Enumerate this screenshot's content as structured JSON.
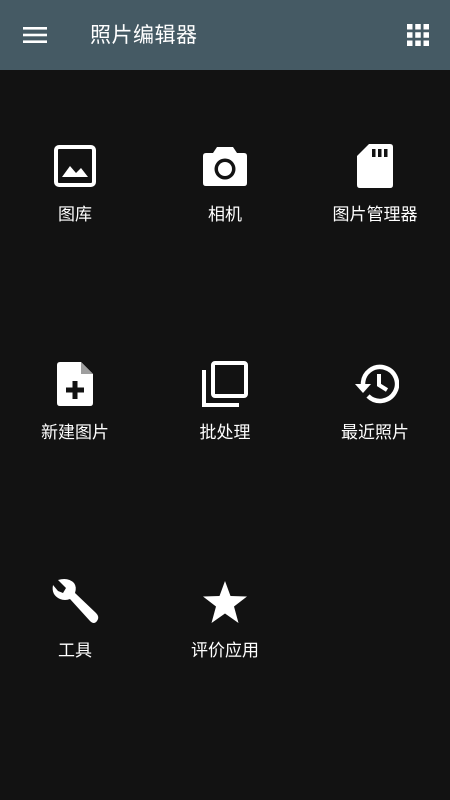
{
  "app_bar": {
    "title": "照片编辑器",
    "menu_icon": "menu-icon",
    "apps_icon": "apps-grid-icon",
    "background": "#455a64"
  },
  "grid": {
    "background": "#121212",
    "items": [
      {
        "label": "图库",
        "icon": "image-icon"
      },
      {
        "label": "相机",
        "icon": "camera-icon"
      },
      {
        "label": "图片管理器",
        "icon": "sd-card-icon"
      },
      {
        "label": "新建图片",
        "icon": "new-file-icon"
      },
      {
        "label": "批处理",
        "icon": "batch-copy-icon"
      },
      {
        "label": "最近照片",
        "icon": "history-icon"
      },
      {
        "label": "工具",
        "icon": "wrench-icon"
      },
      {
        "label": "评价应用",
        "icon": "star-icon"
      }
    ]
  }
}
